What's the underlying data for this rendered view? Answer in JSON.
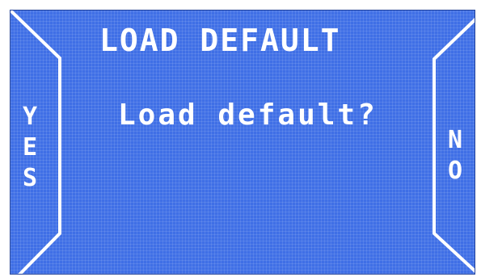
{
  "screen": {
    "title": "LOAD DEFAULT",
    "message": "Load default?"
  },
  "softkeys": {
    "left": {
      "label": "YES",
      "letters": [
        "Y",
        "E",
        "S"
      ]
    },
    "right": {
      "label": "NO",
      "letters": [
        "N",
        "O"
      ]
    }
  },
  "colors": {
    "background": "#3f6fe6",
    "foreground": "#ffffff"
  }
}
